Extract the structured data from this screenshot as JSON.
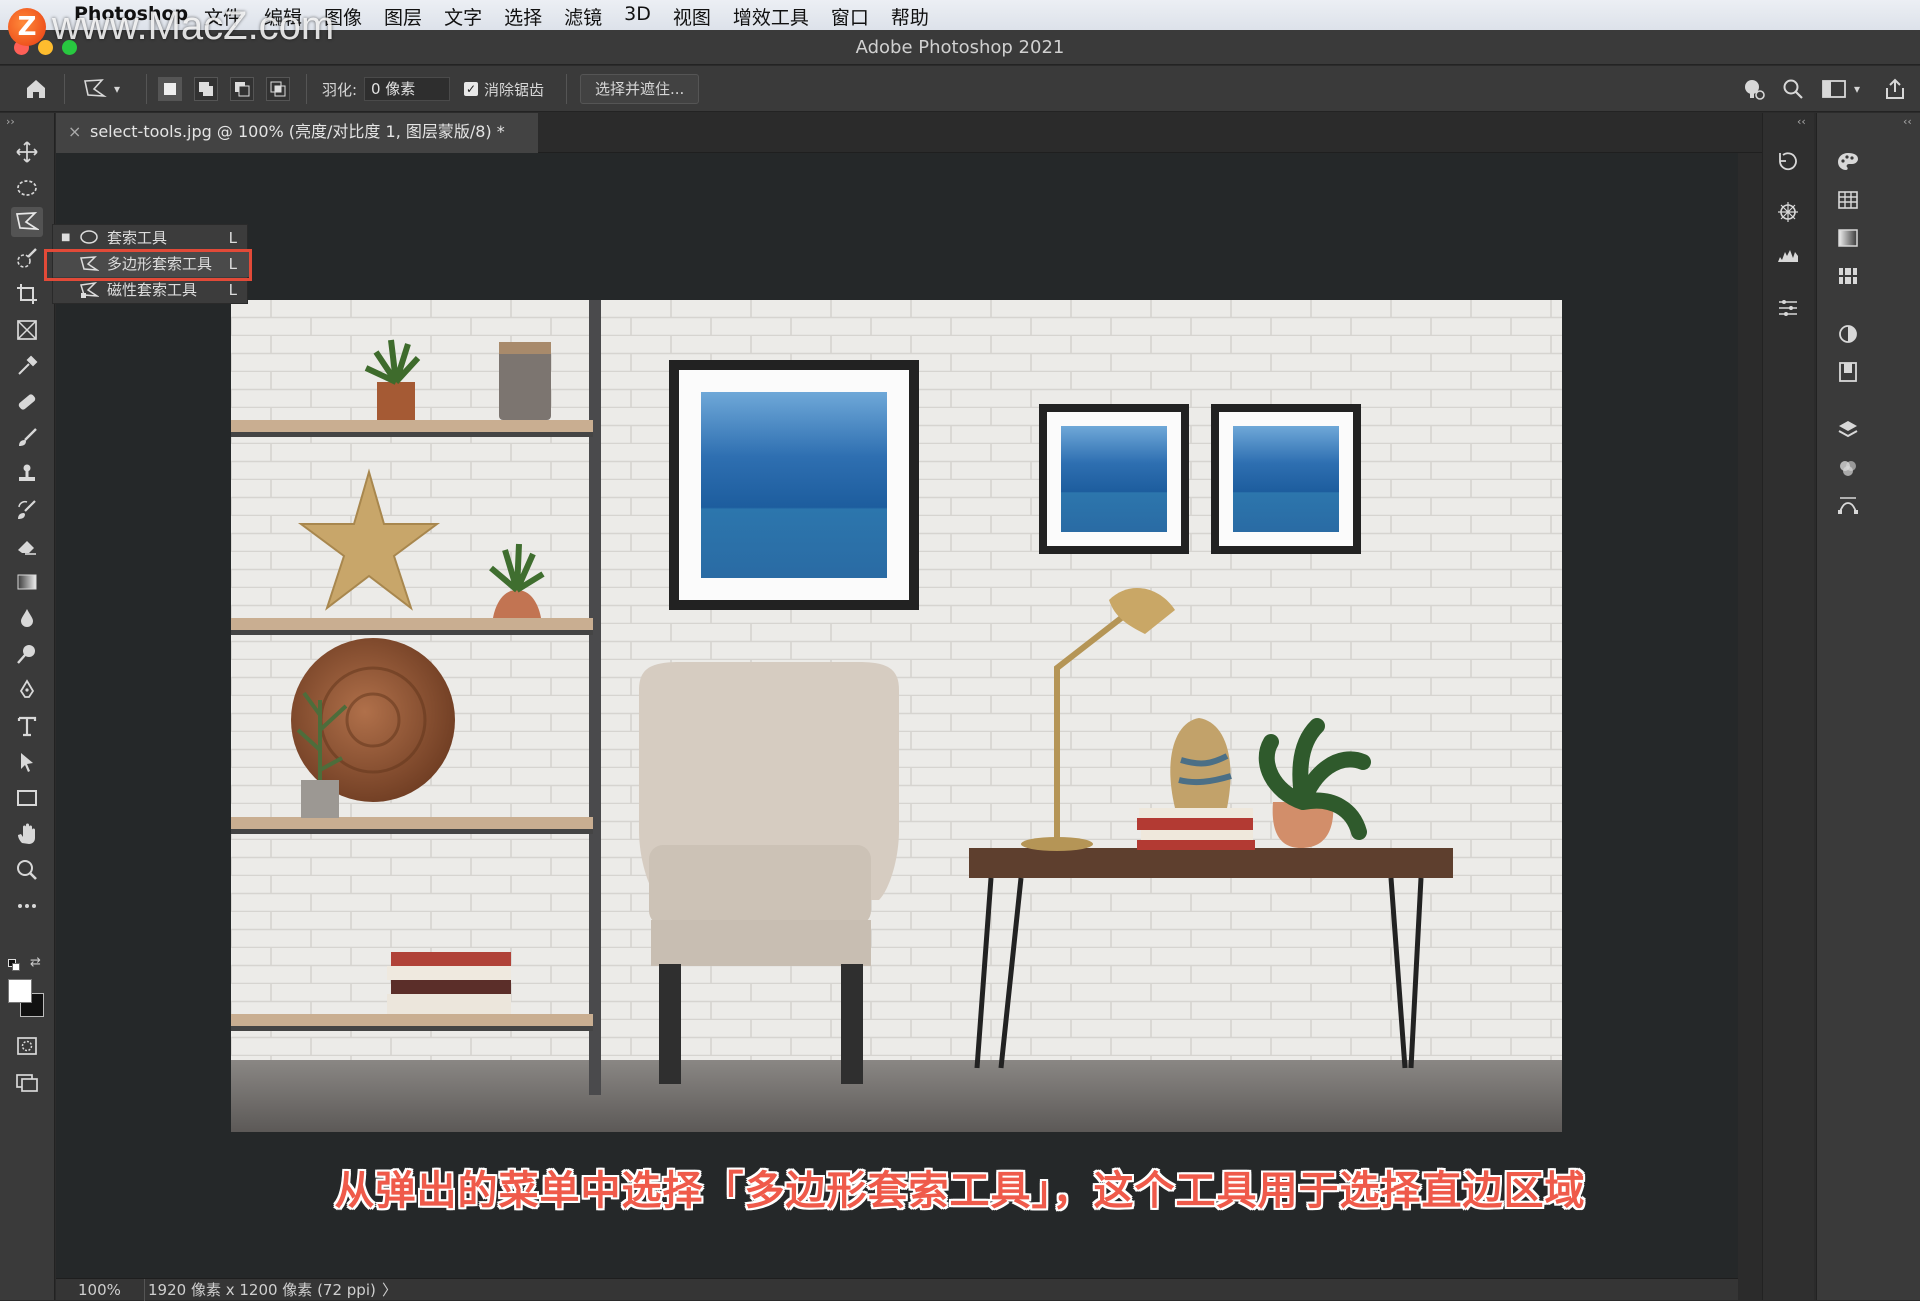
{
  "menubar": {
    "app": "Photoshop",
    "menus": [
      "文件",
      "编辑",
      "图像",
      "图层",
      "文字",
      "选择",
      "滤镜",
      "3D",
      "视图",
      "增效工具",
      "窗口",
      "帮助"
    ]
  },
  "watermark": {
    "text": "www.MacZ.com",
    "badge": "Z"
  },
  "window": {
    "title": "Adobe Photoshop 2021"
  },
  "options": {
    "feather_label": "羽化:",
    "feather_value": "0 像素",
    "antialias_label": "消除锯齿",
    "antialias_checked": true,
    "select_mask_label": "选择并遮住..."
  },
  "document": {
    "tab_title": "select-tools.jpg @ 100% (亮度/对比度 1, 图层蒙版/8) *",
    "close": "×"
  },
  "flyout": {
    "items": [
      {
        "label": "套索工具",
        "key": "L",
        "active": true
      },
      {
        "label": "多边形套索工具",
        "key": "L",
        "highlighted": true
      },
      {
        "label": "磁性套索工具",
        "key": "L"
      }
    ]
  },
  "caption": "从弹出的菜单中选择「多边形套索工具」，这个工具用于选择直边区域",
  "status": {
    "zoom": "100%",
    "size_info": "1920 像素 x 1200 像素 (72 ppi)",
    "arrow": "〉"
  },
  "colors": {
    "highlight_box": "#e24a38",
    "caption": "#ef5a4a",
    "panel": "#3a3a3a",
    "canvas": "#252829"
  },
  "tools": [
    "move-tool-icon",
    "marquee-tool-icon",
    "lasso-tool-icon",
    "quick-select-tool-icon",
    "crop-tool-icon",
    "frame-tool-icon",
    "eyedropper-tool-icon",
    "healing-brush-icon",
    "brush-tool-icon",
    "clone-stamp-icon",
    "history-brush-icon",
    "eraser-tool-icon",
    "gradient-tool-icon",
    "blur-tool-icon",
    "dodge-tool-icon",
    "pen-tool-icon",
    "type-tool-icon",
    "path-select-icon",
    "rectangle-tool-icon",
    "hand-tool-icon",
    "zoom-tool-icon",
    "more-tools-icon"
  ]
}
